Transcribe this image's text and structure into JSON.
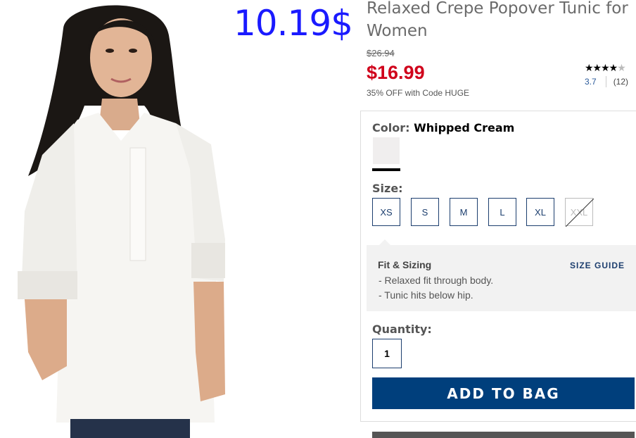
{
  "overlay_price": "10.19$",
  "product": {
    "title": "Relaxed Crepe Popover Tunic for Women",
    "original_price": "$26.94",
    "sale_price": "$16.99",
    "promo": "35% OFF with Code HUGE"
  },
  "rating": {
    "stars_filled": "★★★★",
    "stars_empty": "★",
    "value": "3.7",
    "count": "(12)"
  },
  "color": {
    "label": "Color:",
    "value": "Whipped Cream",
    "swatch_hex": "#f0eeee"
  },
  "size": {
    "label": "Size:",
    "options": [
      "XS",
      "S",
      "M",
      "L",
      "XL",
      "XXL"
    ],
    "unavailable": "XXL"
  },
  "fit": {
    "title": "Fit & Sizing",
    "guide_link": "SIZE GUIDE",
    "lines": [
      "- Relaxed fit through body.",
      "- Tunic hits below hip."
    ]
  },
  "quantity": {
    "label": "Quantity:",
    "value": "1"
  },
  "add_to_bag": "ADD TO BAG",
  "colors": {
    "sale_red": "#d0021b",
    "brand_navy": "#003f7c",
    "overlay_blue": "#1a1aff"
  }
}
